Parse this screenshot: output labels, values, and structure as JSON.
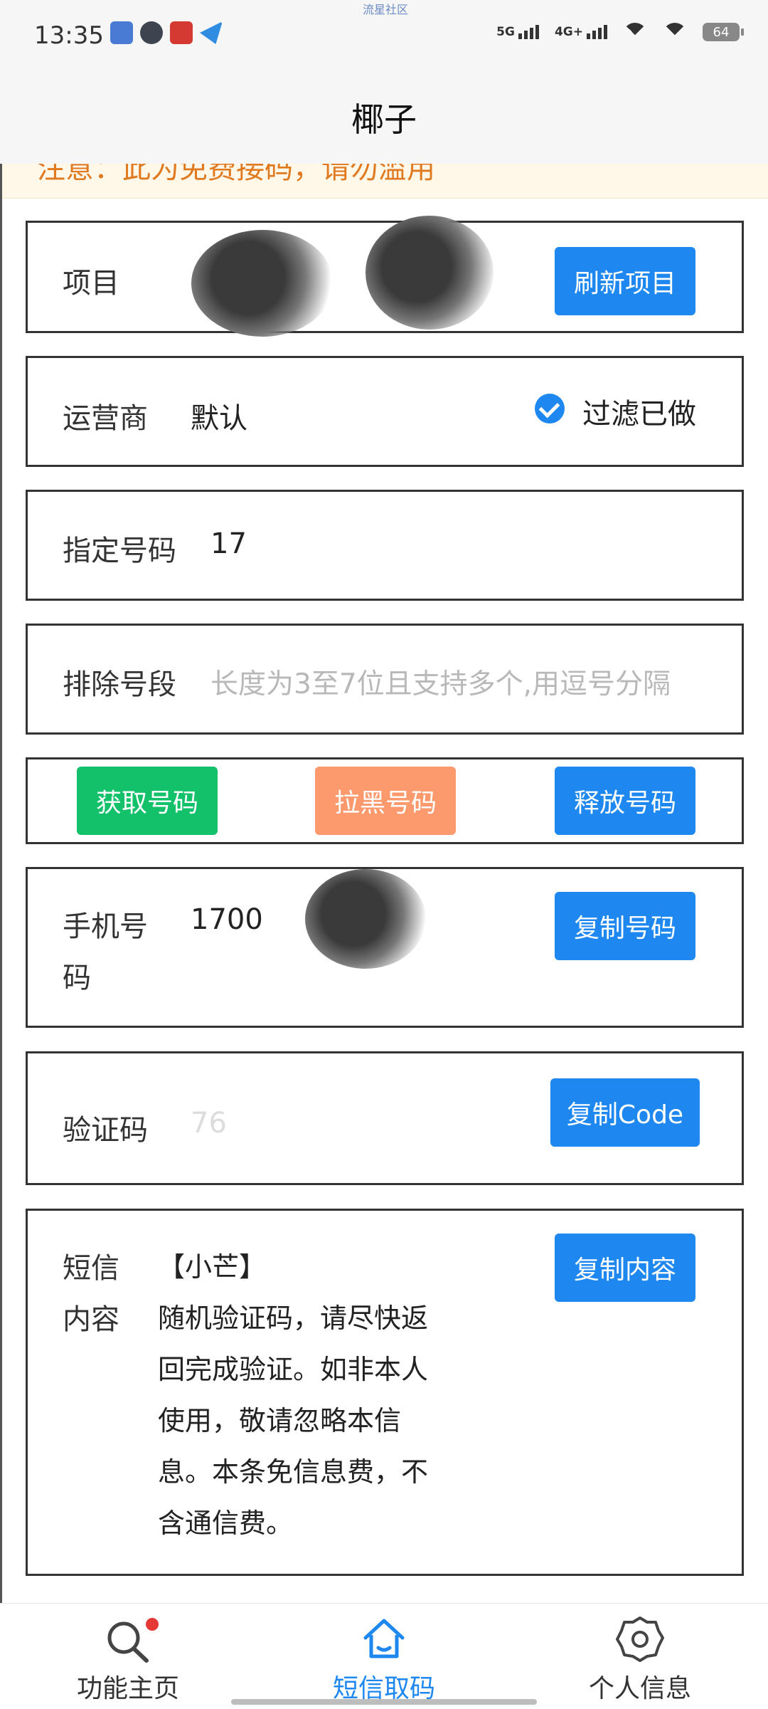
{
  "status_bar": {
    "time": "13:35",
    "watermark": "流星社区",
    "signal_1": "5G",
    "signal_2": "4G+",
    "battery": "64"
  },
  "title": "椰子",
  "notice_text": "注意：此为免费接码，请勿滥用",
  "project": {
    "label": "项目",
    "button": "刷新项目"
  },
  "operator": {
    "label": "运营商",
    "value": "默认",
    "filter_label": "过滤已做",
    "filter_checked": true
  },
  "specified_number": {
    "label": "指定号码",
    "value": "17"
  },
  "exclude_segment": {
    "label": "排除号段",
    "placeholder": "长度为3至7位且支持多个,用逗号分隔"
  },
  "actions": {
    "get": "获取号码",
    "block": "拉黑号码",
    "release": "释放号码"
  },
  "phone": {
    "label_line1": "手机号",
    "label_line2": "码",
    "value": "1700",
    "button": "复制号码"
  },
  "code": {
    "label": "验证码",
    "value": "76",
    "button": "复制Code"
  },
  "sms": {
    "label_line1": "短信",
    "label_line2": "内容",
    "lines": [
      "【小芒】",
      "随机验证码，请尽快返",
      "回完成验证。如非本人",
      "使用，敬请忽略本信",
      "息。本条免信息费，不",
      "含通信费。"
    ],
    "button": "复制内容"
  },
  "nav": {
    "items": [
      {
        "label": "功能主页",
        "icon": "search-icon",
        "badge": true
      },
      {
        "label": "短信取码",
        "icon": "home-icon",
        "active": true
      },
      {
        "label": "个人信息",
        "icon": "gear-icon"
      }
    ]
  },
  "colors": {
    "primary": "#1e88f0",
    "success": "#13c16a",
    "warning": "#fc9a6e"
  }
}
